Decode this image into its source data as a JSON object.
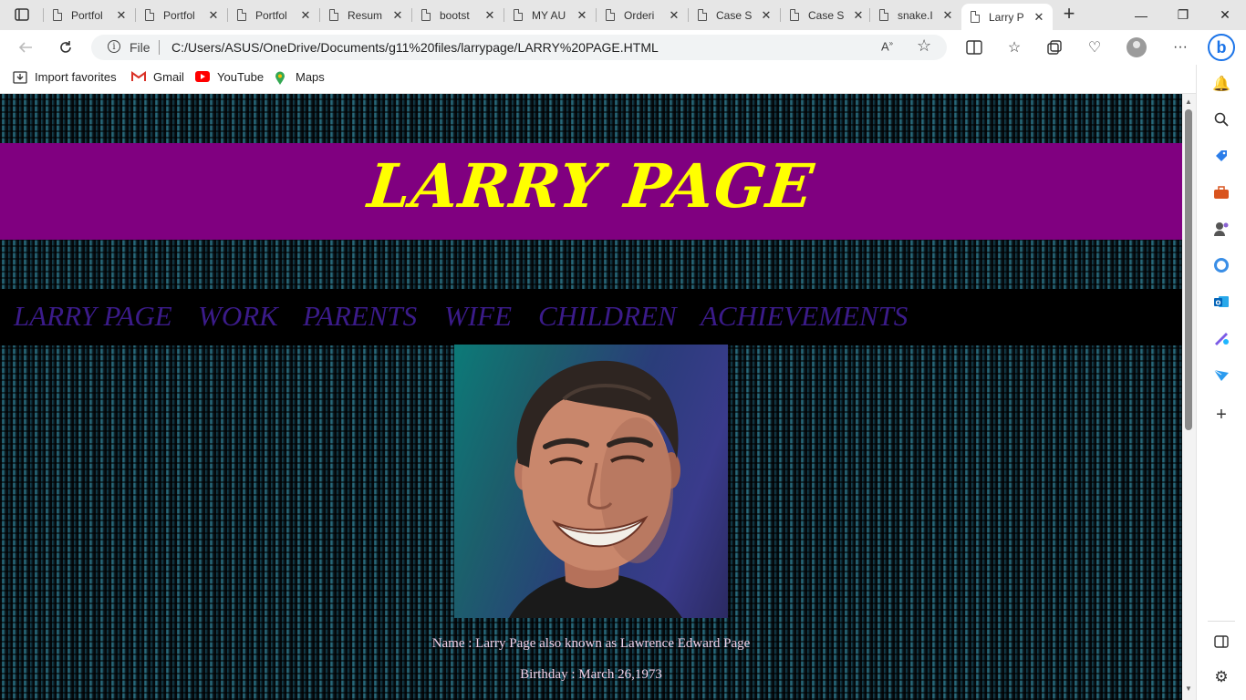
{
  "browser": {
    "tabs": [
      {
        "title": "Portfol"
      },
      {
        "title": "Portfol"
      },
      {
        "title": "Portfol"
      },
      {
        "title": "Resum"
      },
      {
        "title": "bootst"
      },
      {
        "title": "MY AU"
      },
      {
        "title": "Orderi"
      },
      {
        "title": "Case S"
      },
      {
        "title": "Case S"
      },
      {
        "title": "snake.I"
      },
      {
        "title": "Larry P",
        "active": true
      }
    ],
    "new_tab_symbol": "+",
    "window_controls": {
      "minimize": "—",
      "restore": "❐",
      "close": "✕"
    },
    "address": {
      "scheme": "File",
      "url": "C:/Users/ASUS/OneDrive/Documents/g11%20files/larrypage/LARRY%20PAGE.HTML"
    },
    "favorites": [
      {
        "label": "Import favorites",
        "icon": "import-icon"
      },
      {
        "label": "Gmail",
        "icon": "gmail-icon"
      },
      {
        "label": "YouTube",
        "icon": "youtube-icon"
      },
      {
        "label": "Maps",
        "icon": "maps-icon"
      }
    ],
    "sidebar_icons": [
      "bell-icon",
      "search-icon",
      "shopping-tag-icon",
      "toolbox-icon",
      "games-icon",
      "office-icon",
      "outlook-icon",
      "designer-icon",
      "send-icon",
      "add-icon",
      "sidebar-toggle-icon",
      "settings-icon"
    ]
  },
  "page": {
    "banner_title": "LARRY PAGE",
    "menu": [
      "LARRY PAGE",
      "WORK",
      "PARENTS",
      "WIFE",
      "CHILDREN",
      "ACHIEVEMENTS"
    ],
    "info": [
      "Name : Larry Page also known as Lawrence Edward Page",
      "Birthday : March 26,1973"
    ]
  },
  "colors": {
    "banner_bg": "#800080",
    "banner_text": "#ffff00",
    "menu_text": "#3b1b8a",
    "info_text": "#f0d0e8"
  }
}
